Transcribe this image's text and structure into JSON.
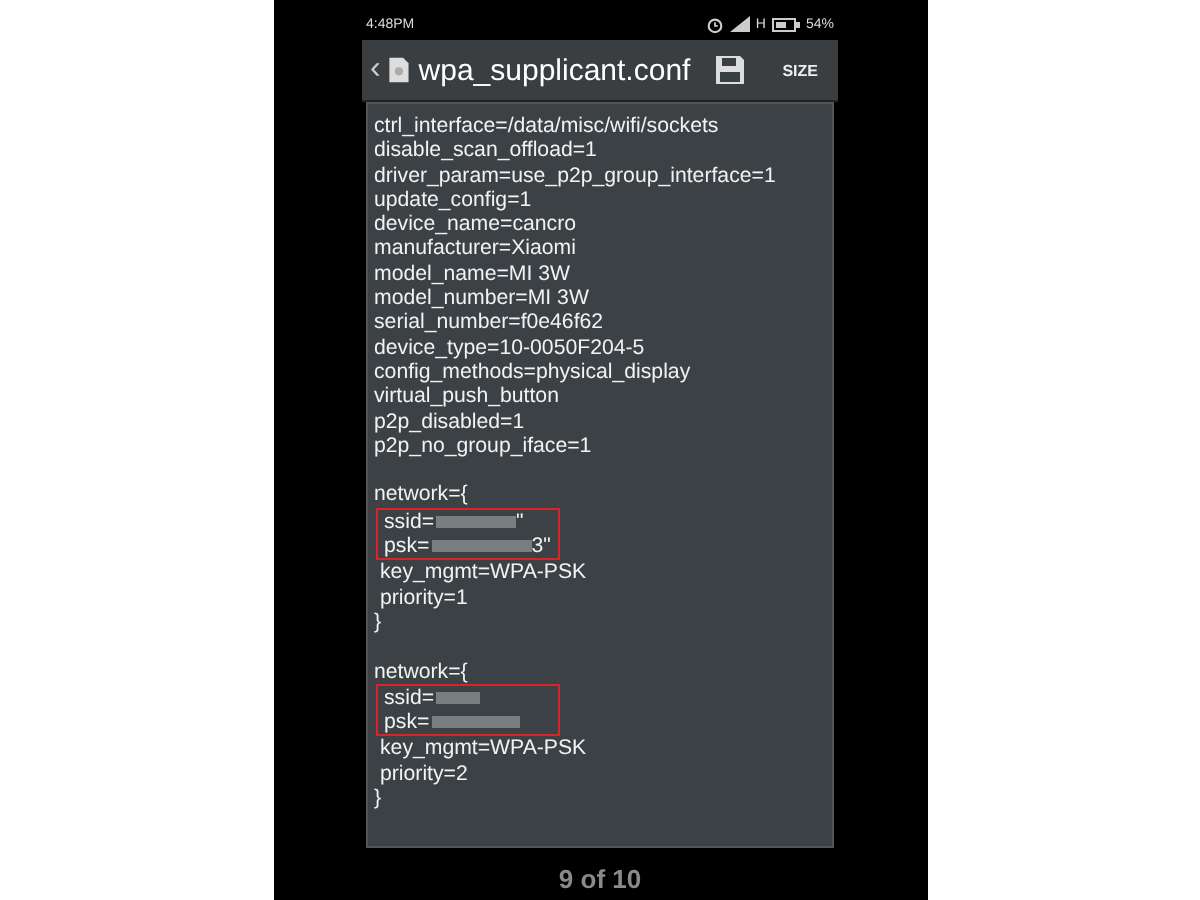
{
  "status_bar": {
    "time": "4:48PM",
    "network": "H",
    "battery": "54%"
  },
  "app_bar": {
    "back": "‹",
    "title": "wpa_supplicant.conf",
    "size_button": "SIZE"
  },
  "editor": {
    "lines": [
      "ctrl_interface=/data/misc/wifi/sockets",
      "disable_scan_offload=1",
      "driver_param=use_p2p_group_interface=1",
      "update_config=1",
      "device_name=cancro",
      "manufacturer=Xiaomi",
      "model_name=MI 3W",
      "model_number=MI 3W",
      "serial_number=f0e46f62",
      "device_type=10-0050F204-5",
      "config_methods=physical_display",
      "virtual_push_button",
      "p2p_disabled=1",
      "p2p_no_group_iface=1"
    ],
    "networks": [
      {
        "header": "network={",
        "secrets": [
          {
            "key": "ssid=",
            "tail": "\""
          },
          {
            "key": "psk=",
            "tail": "3\""
          }
        ],
        "lines": [
          "key_mgmt=WPA-PSK",
          "priority=1"
        ],
        "closing": "}"
      },
      {
        "header": "network={",
        "secrets": [
          {
            "key": "ssid="
          },
          {
            "key": "psk="
          }
        ],
        "lines": [
          "key_mgmt=WPA-PSK",
          "priority=2"
        ],
        "closing": "}"
      }
    ]
  },
  "pager": "9 of 10"
}
